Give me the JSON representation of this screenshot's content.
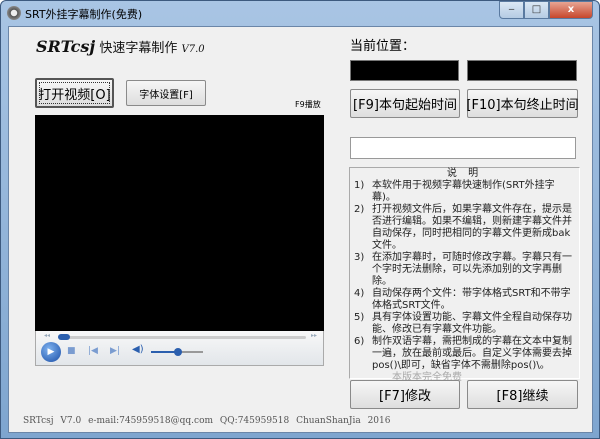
{
  "window": {
    "title": "SRT外挂字幕制作(免费)",
    "minimize": "‒",
    "maximize": "□",
    "close": "x"
  },
  "logo": {
    "brand": "SRTcsj",
    "name": "快速字幕制作",
    "version": "V7.0"
  },
  "buttons": {
    "open_video": "打开视频[O]",
    "font_settings": "字体设置[F]",
    "f9_play": "F9播放",
    "start_time": "[F9]本句起始时间",
    "end_time": "[F10]本句终止时间",
    "edit": "[F7]修改",
    "continue": "[F8]继续"
  },
  "position_label": "当前位置：",
  "subtitle_input": {
    "value": ""
  },
  "player": {
    "seek_progress": 0.03,
    "volume": 0.5
  },
  "description": {
    "heading": "说 明",
    "items": [
      {
        "n": "1)",
        "text": "本软件用于视频字幕快速制作(SRT外挂字幕)。"
      },
      {
        "n": "2)",
        "text": "打开视频文件后，如果字幕文件存在，提示是否进行编辑。如果不编辑，则新建字幕文件并自动保存，同时把相同的字幕文件更新成bak文件。"
      },
      {
        "n": "3)",
        "text": "在添加字幕时，可随时修改字幕。字幕只有一个字时无法删除，可以先添加别的文字再删除。"
      },
      {
        "n": "4)",
        "text": "自动保存两个文件：带字体格式SRT和不带字体格式SRT文件。"
      },
      {
        "n": "5)",
        "text": "具有字体设置功能、字幕文件全程自动保存功能、修改已有字幕文件功能。"
      },
      {
        "n": "6)",
        "text": "制作双语字幕，需把制成的字幕在文本中复制一遍，放在最前或最后。自定义字体需要去掉pos()\\即可，缺省字体不需删除pos()\\。"
      }
    ],
    "free_note": "本版本完全免费"
  },
  "footer": "SRTcsj V7.0   e-mail:745959518@qq.com   QQ:745959518   ChuanShanJia 2016"
}
